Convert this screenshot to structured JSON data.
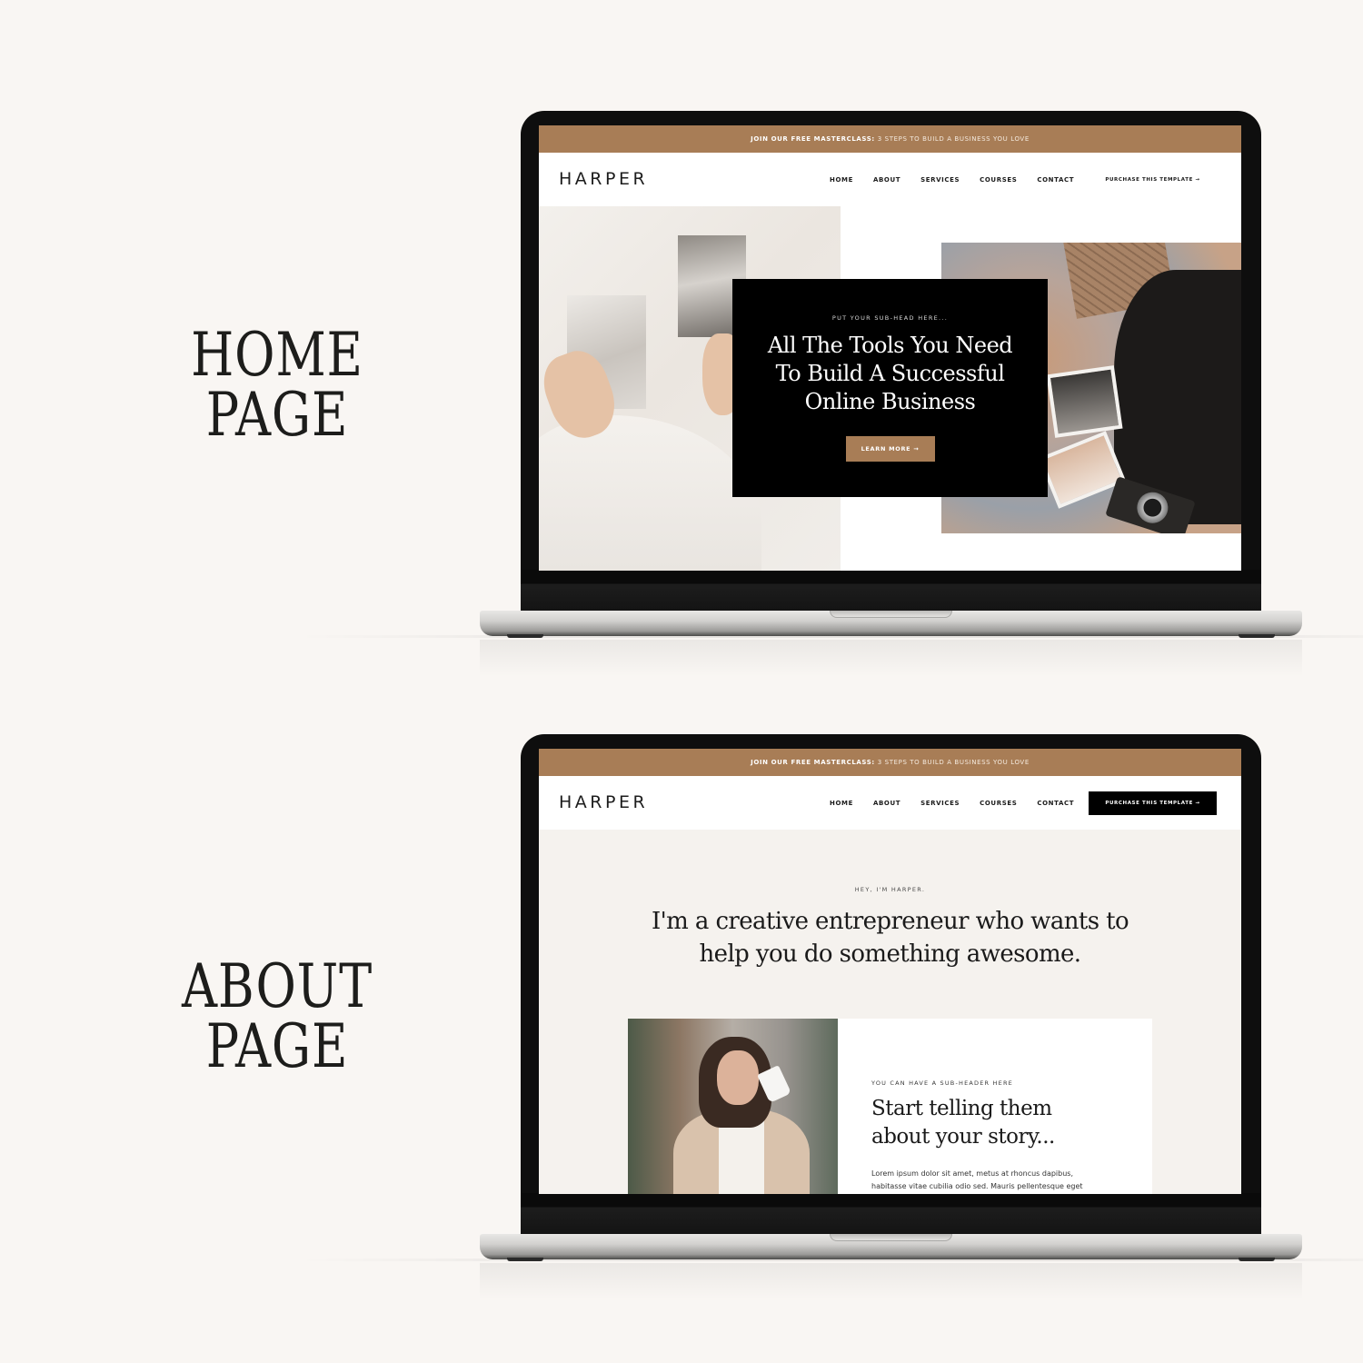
{
  "labels": {
    "home": [
      "HOME",
      "PAGE"
    ],
    "about": [
      "ABOUT",
      "PAGE"
    ]
  },
  "site": {
    "banner_bold": "JOIN OUR FREE MASTERCLASS:",
    "banner_rest": "3 STEPS TO BUILD A BUSINESS YOU LOVE",
    "logo": "HARPER",
    "nav": [
      "HOME",
      "ABOUT",
      "SERVICES",
      "COURSES",
      "CONTACT"
    ],
    "purchase_label": "PURCHASE THIS TEMPLATE →",
    "accent_color": "#a87d56"
  },
  "home": {
    "subhead": "PUT YOUR SUB-HEAD HERE...",
    "title_lines": [
      "All The Tools You Need",
      "To Build A Successful",
      "Online Business"
    ],
    "cta_label": "LEARN MORE →"
  },
  "about": {
    "eyebrow": "HEY, I'M HARPER.",
    "title_lines": [
      "I'm a creative entrepreneur who wants to",
      "help you do something awesome."
    ],
    "sub": "YOU CAN HAVE A SUB-HEADER HERE",
    "heading_lines": [
      "Start telling them",
      "about your story..."
    ],
    "body_lines": [
      "Lorem ipsum dolor sit amet, metus at rhoncus dapibus,",
      "habitasse vitae cubilia odio sed. Mauris pellentesque eget"
    ]
  }
}
